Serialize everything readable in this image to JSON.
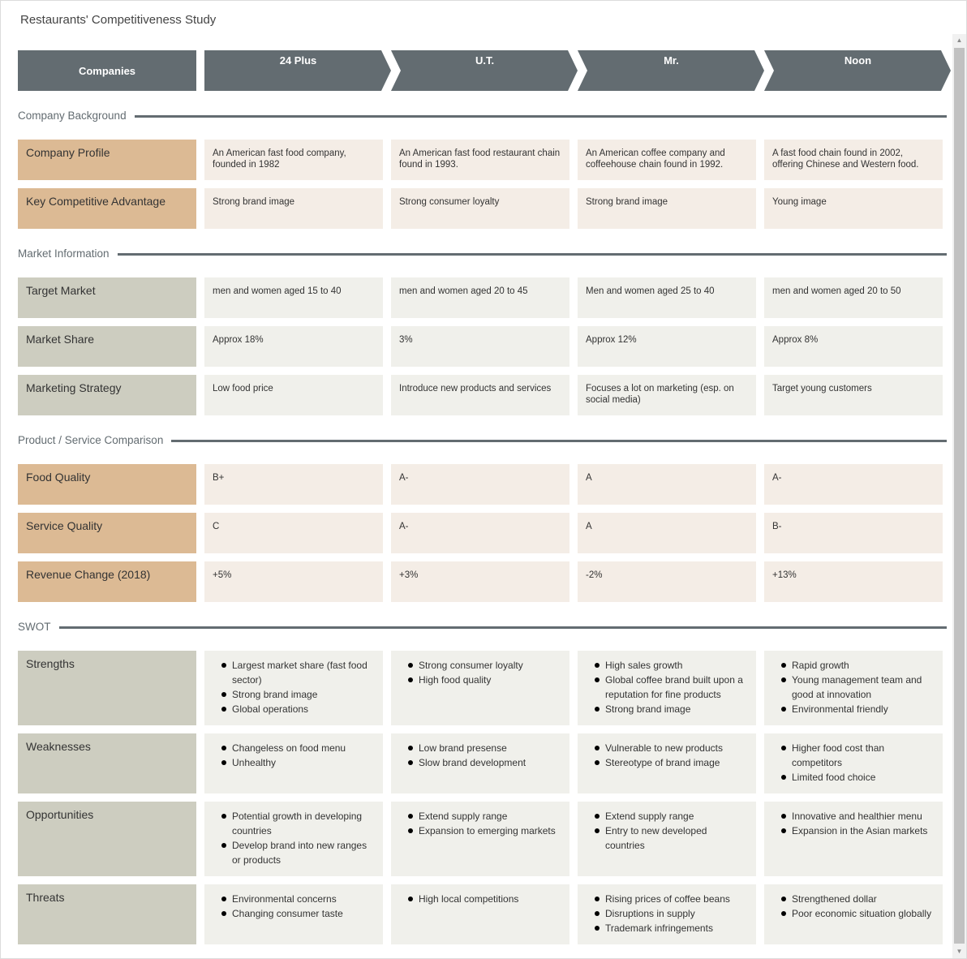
{
  "title": "Restaurants' Competitiveness Study",
  "header": {
    "first_column": "Companies",
    "companies": [
      "24 Plus",
      "U.T.",
      "Mr.",
      "Noon"
    ]
  },
  "colors": {
    "header": "#636c71",
    "tan_label": "#dcba94",
    "tan_cell": "#f4ede6",
    "gray_label": "#cdcdc0",
    "gray_cell": "#f0f0eb"
  },
  "sections": [
    {
      "title": "Company Background",
      "rows": [
        {
          "label": "Company Profile",
          "values": [
            "An American fast food company, founded in 1982",
            "An American fast food restaurant chain found in 1993.",
            "An American coffee company and coffeehouse chain found in 1992.",
            "A fast food chain found in 2002, offering Chinese and Western food."
          ]
        },
        {
          "label": "Key Competitive Advantage",
          "values": [
            "Strong brand image",
            "Strong consumer loyalty",
            "Strong brand image",
            "Young image"
          ]
        }
      ]
    },
    {
      "title": "Market Information",
      "rows": [
        {
          "label": "Target Market",
          "values": [
            "men and women aged 15 to 40",
            "men and women aged 20 to 45",
            "Men and women aged 25 to 40",
            "men and women aged 20 to 50"
          ]
        },
        {
          "label": "Market Share",
          "values": [
            "Approx 18%",
            "3%",
            "Approx 12%",
            "Approx 8%"
          ]
        },
        {
          "label": "Marketing Strategy",
          "values": [
            "Low food price",
            "Introduce new products and services",
            "Focuses a lot on marketing (esp. on social media)",
            "Target young customers"
          ]
        }
      ]
    },
    {
      "title": "Product / Service Comparison",
      "rows": [
        {
          "label": "Food Quality",
          "values": [
            "B+",
            "A-",
            "A",
            "A-"
          ]
        },
        {
          "label": "Service Quality",
          "values": [
            "C",
            "A-",
            "A",
            "B-"
          ]
        },
        {
          "label": "Revenue Change (2018)",
          "values": [
            "+5%",
            "+3%",
            "-2%",
            "+13%"
          ]
        }
      ]
    },
    {
      "title": "SWOT",
      "rows": [
        {
          "label": "Strengths",
          "values": [
            [
              "Largest market share (fast food sector)",
              "Strong brand image",
              "Global operations"
            ],
            [
              "Strong consumer loyalty",
              "High food quality"
            ],
            [
              "High sales growth",
              "Global coffee brand built upon a reputation for fine products",
              "Strong brand image"
            ],
            [
              "Rapid growth",
              "Young management team and good at innovation",
              "Environmental friendly"
            ]
          ]
        },
        {
          "label": "Weaknesses",
          "values": [
            [
              "Changeless on food menu",
              "Unhealthy"
            ],
            [
              "Low brand presense",
              "Slow brand development"
            ],
            [
              "Vulnerable to new products",
              "Stereotype of brand image"
            ],
            [
              "Higher food cost than competitors",
              "Limited food choice"
            ]
          ]
        },
        {
          "label": "Opportunities",
          "values": [
            [
              "Potential growth in developing countries",
              "Develop brand into new ranges or products"
            ],
            [
              "Extend supply range",
              "Expansion to emerging markets"
            ],
            [
              "Extend supply range",
              "Entry to new developed countries"
            ],
            [
              "Innovative and healthier menu",
              "Expansion in the Asian markets"
            ]
          ]
        },
        {
          "label": "Threats",
          "values": [
            [
              "Environmental concerns",
              "Changing consumer taste"
            ],
            [
              "High local competitions"
            ],
            [
              "Rising prices of coffee beans",
              "Disruptions in supply",
              "Trademark infringements"
            ],
            [
              "Strengthened dollar",
              "Poor economic situation globally"
            ]
          ]
        }
      ]
    }
  ],
  "scrollbar": {
    "up_icon": "▲",
    "down_icon": "▼"
  }
}
